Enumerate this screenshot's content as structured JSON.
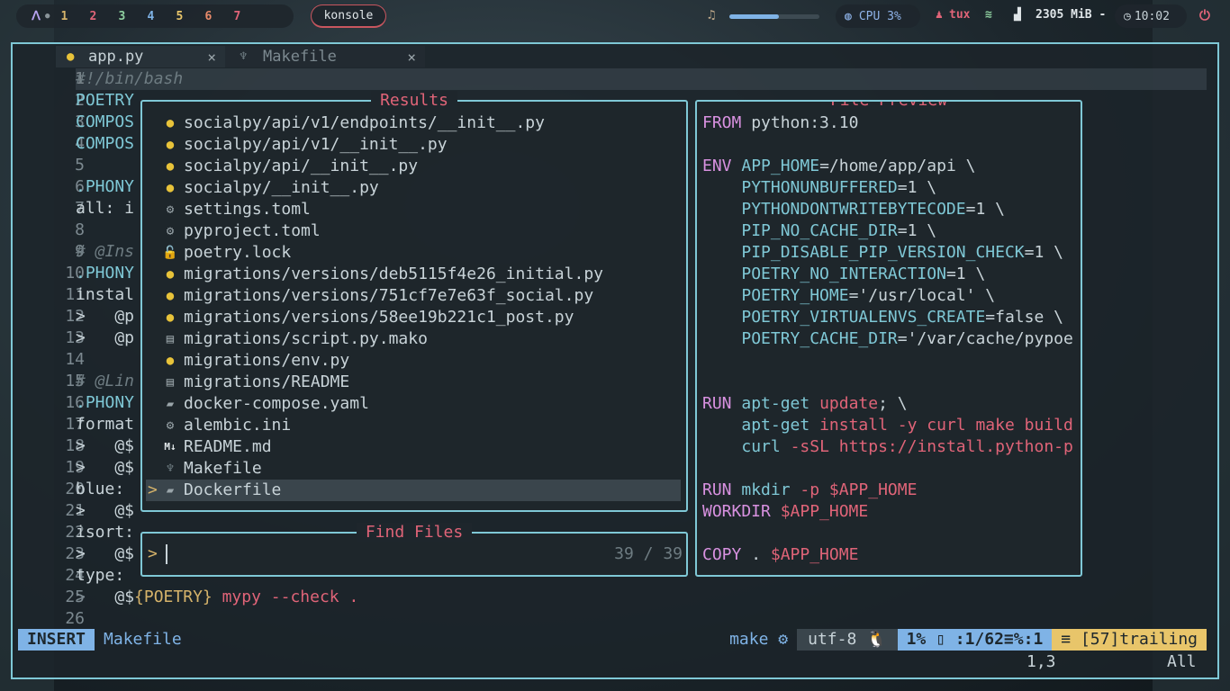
{
  "topbar": {
    "logo": "ᐱ",
    "workspaces": [
      "1",
      "2",
      "3",
      "4",
      "5",
      "6",
      "7"
    ],
    "workspace_colors": [
      "#d6b36a",
      "#e06478",
      "#8fd0a0",
      "#7fb3e6",
      "#e8c56a",
      "#e88a6a",
      "#e06478"
    ],
    "active_window": "konsole",
    "volume_level": 0.55,
    "cpu": "CPU 3%",
    "user": "tux",
    "memory": "2305 MiB -",
    "clock": "10:02"
  },
  "tabs": [
    {
      "label": "app.py",
      "close": "×"
    },
    {
      "label": "Makefile",
      "close": "×"
    }
  ],
  "editor": {
    "lines": [
      {
        "n": "1",
        "text": "#!/bin/bash"
      },
      {
        "n": "2",
        "text": "POETRY"
      },
      {
        "n": "3",
        "text": "COMPOS"
      },
      {
        "n": "4",
        "text": "COMPOS"
      },
      {
        "n": "5",
        "text": ""
      },
      {
        "n": "6",
        "text": ".PHONY"
      },
      {
        "n": "7",
        "text": "all: i"
      },
      {
        "n": "8",
        "text": ""
      },
      {
        "n": "9",
        "text": "# @Ins"
      },
      {
        "n": "10",
        "text": ".PHONY"
      },
      {
        "n": "11",
        "text": "instal"
      },
      {
        "n": "12",
        "text": ">   @p"
      },
      {
        "n": "13",
        "text": ">   @p"
      },
      {
        "n": "14",
        "text": ""
      },
      {
        "n": "15",
        "text": "# @Lin"
      },
      {
        "n": "16",
        "text": ".PHONY"
      },
      {
        "n": "17",
        "text": "format"
      },
      {
        "n": "18",
        "text": ">   @$"
      },
      {
        "n": "19",
        "text": ">   @$"
      },
      {
        "n": "20",
        "text": "blue:"
      },
      {
        "n": "21",
        "text": ">   @$"
      },
      {
        "n": "22",
        "text": "isort:"
      },
      {
        "n": "23",
        "text": ">   @$"
      },
      {
        "n": "24",
        "text": "type:"
      },
      {
        "n": "25",
        "text": ">   @${POETRY} mypy --check ."
      },
      {
        "n": "26",
        "text": ""
      }
    ]
  },
  "results": {
    "title": "Results",
    "items": [
      {
        "icon": "python-icon",
        "glyph": "●",
        "color": "#e8c33a",
        "path": "socialpy/api/v1/endpoints/__init__.py"
      },
      {
        "icon": "python-icon",
        "glyph": "●",
        "color": "#e8c33a",
        "path": "socialpy/api/v1/__init__.py"
      },
      {
        "icon": "python-icon",
        "glyph": "●",
        "color": "#e8c33a",
        "path": "socialpy/api/__init__.py"
      },
      {
        "icon": "python-icon",
        "glyph": "●",
        "color": "#e8c33a",
        "path": "socialpy/__init__.py"
      },
      {
        "icon": "gear-icon",
        "glyph": "⚙",
        "color": "#9aa5aa",
        "path": "settings.toml"
      },
      {
        "icon": "gear-icon",
        "glyph": "⚙",
        "color": "#9aa5aa",
        "path": "pyproject.toml"
      },
      {
        "icon": "lock-icon",
        "glyph": "🔓",
        "color": "#c8d3d8",
        "path": "poetry.lock"
      },
      {
        "icon": "python-icon",
        "glyph": "●",
        "color": "#e8c33a",
        "path": "migrations/versions/deb5115f4e26_initial.py"
      },
      {
        "icon": "python-icon",
        "glyph": "●",
        "color": "#e8c33a",
        "path": "migrations/versions/751cf7e7e63f_social.py"
      },
      {
        "icon": "python-icon",
        "glyph": "●",
        "color": "#e8c33a",
        "path": "migrations/versions/58ee19b221c1_post.py"
      },
      {
        "icon": "file-icon",
        "glyph": "▤",
        "color": "#9aa5aa",
        "path": "migrations/script.py.mako"
      },
      {
        "icon": "python-icon",
        "glyph": "●",
        "color": "#e8c33a",
        "path": "migrations/env.py"
      },
      {
        "icon": "file-icon",
        "glyph": "▤",
        "color": "#9aa5aa",
        "path": "migrations/README"
      },
      {
        "icon": "docker-icon",
        "glyph": "▰",
        "color": "#9aa5aa",
        "path": "docker-compose.yaml"
      },
      {
        "icon": "gear-icon",
        "glyph": "⚙",
        "color": "#9aa5aa",
        "path": "alembic.ini"
      },
      {
        "icon": "markdown-icon",
        "glyph": "M↓",
        "color": "#e0e6e9",
        "path": "README.md"
      },
      {
        "icon": "makefile-icon",
        "glyph": "♆",
        "color": "#6e7c82",
        "path": "Makefile"
      },
      {
        "icon": "docker-icon",
        "glyph": "▰",
        "color": "#9aa5aa",
        "path": "Dockerfile",
        "selected": true,
        "caret": ">"
      }
    ]
  },
  "find": {
    "title": "Find Files",
    "prompt": ">",
    "count": "39 / 39"
  },
  "preview": {
    "title": "File Preview",
    "lines": [
      [
        [
          "kw",
          "FROM"
        ],
        [
          "txt",
          " python:3.10"
        ]
      ],
      [],
      [
        [
          "kw",
          "ENV"
        ],
        [
          "txt",
          " "
        ],
        [
          "var",
          "APP_HOME"
        ],
        [
          "txt",
          "=/home/app/api \\"
        ]
      ],
      [
        [
          "txt",
          "    "
        ],
        [
          "var",
          "PYTHONUNBUFFERED"
        ],
        [
          "txt",
          "=1 \\"
        ]
      ],
      [
        [
          "txt",
          "    "
        ],
        [
          "var",
          "PYTHONDONTWRITEBYTECODE"
        ],
        [
          "txt",
          "=1 \\"
        ]
      ],
      [
        [
          "txt",
          "    "
        ],
        [
          "var",
          "PIP_NO_CACHE_DIR"
        ],
        [
          "txt",
          "=1 \\"
        ]
      ],
      [
        [
          "txt",
          "    "
        ],
        [
          "var",
          "PIP_DISABLE_PIP_VERSION_CHECK"
        ],
        [
          "txt",
          "=1 \\"
        ]
      ],
      [
        [
          "txt",
          "    "
        ],
        [
          "var",
          "POETRY_NO_INTERACTION"
        ],
        [
          "txt",
          "=1 \\"
        ]
      ],
      [
        [
          "txt",
          "    "
        ],
        [
          "var",
          "POETRY_HOME"
        ],
        [
          "txt",
          "='/usr/local' \\"
        ]
      ],
      [
        [
          "txt",
          "    "
        ],
        [
          "var",
          "POETRY_VIRTUALENVS_CREATE"
        ],
        [
          "txt",
          "=false \\"
        ]
      ],
      [
        [
          "txt",
          "    "
        ],
        [
          "var",
          "POETRY_CACHE_DIR"
        ],
        [
          "txt",
          "='/var/cache/pypoe"
        ]
      ],
      [],
      [],
      [
        [
          "kw",
          "RUN"
        ],
        [
          "txt",
          " "
        ],
        [
          "var",
          "apt-get"
        ],
        [
          "txt",
          " "
        ],
        [
          "red",
          "update"
        ],
        [
          "txt",
          "; \\"
        ]
      ],
      [
        [
          "txt",
          "    "
        ],
        [
          "var",
          "apt-get"
        ],
        [
          "txt",
          " "
        ],
        [
          "red",
          "install -y curl make build"
        ]
      ],
      [
        [
          "txt",
          "    "
        ],
        [
          "var",
          "curl"
        ],
        [
          "txt",
          " "
        ],
        [
          "red",
          "-sSL https://install.python-p"
        ]
      ],
      [],
      [
        [
          "kw",
          "RUN"
        ],
        [
          "txt",
          " "
        ],
        [
          "var",
          "mkdir"
        ],
        [
          "txt",
          " "
        ],
        [
          "red",
          "-p $APP_HOME"
        ]
      ],
      [
        [
          "kw",
          "WORKDIR"
        ],
        [
          "txt",
          " "
        ],
        [
          "red",
          "$APP_HOME"
        ]
      ],
      [],
      [
        [
          "kw",
          "COPY"
        ],
        [
          "txt",
          " . "
        ],
        [
          "red",
          "$APP_HOME"
        ]
      ]
    ]
  },
  "statusline": {
    "mode": "INSERT",
    "filename": "Makefile",
    "filetype": "make ⚙",
    "encoding": "utf-8 🐧",
    "position": "1% ▯ :1/62≡%:1",
    "trailing": "≡ [57]trailing",
    "cursor": "1,3",
    "scroll": "All"
  },
  "colors": {
    "accent": "#7fc8d6",
    "title_red": "#e06478",
    "insert_blue": "#7fb3e6",
    "trailing_yellow": "#e8c56a"
  }
}
